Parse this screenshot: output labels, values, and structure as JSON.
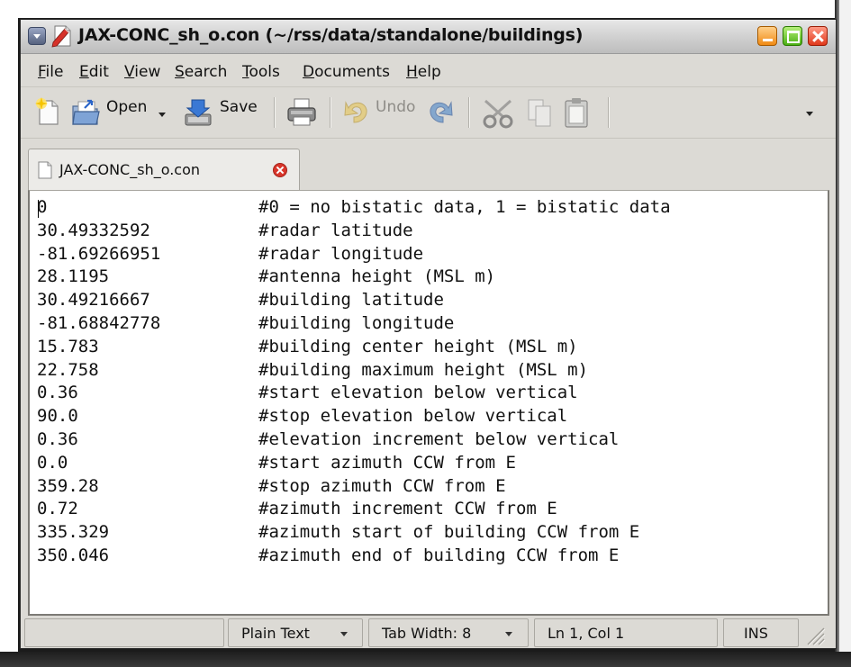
{
  "window": {
    "title": "JAX-CONC_sh_o.con (~/rss/data/standalone/buildings)"
  },
  "menu": [
    "File",
    "Edit",
    "View",
    "Search",
    "Tools",
    "Documents",
    "Help"
  ],
  "toolbar": {
    "new_icon": "new-document-icon",
    "open_label": "Open",
    "save_label": "Save",
    "print_icon": "print-icon",
    "undo_label": "Undo",
    "redo_icon": "redo-icon",
    "cut_icon": "cut-icon",
    "copy_icon": "copy-icon",
    "paste_icon": "paste-icon"
  },
  "tab": {
    "label": "JAX-CONC_sh_o.con"
  },
  "editor": {
    "lines": [
      {
        "value": "0",
        "comment": "#0 = no bistatic data, 1 = bistatic data"
      },
      {
        "value": "30.49332592",
        "comment": "#radar latitude"
      },
      {
        "value": "-81.69266951",
        "comment": "#radar longitude"
      },
      {
        "value": "28.1195",
        "comment": "#antenna height (MSL m)"
      },
      {
        "value": "30.49216667",
        "comment": "#building latitude"
      },
      {
        "value": "-81.68842778",
        "comment": "#building longitude"
      },
      {
        "value": "15.783",
        "comment": "#building center height (MSL m)"
      },
      {
        "value": "22.758",
        "comment": "#building maximum height (MSL m)"
      },
      {
        "value": "0.36",
        "comment": "#start elevation below vertical"
      },
      {
        "value": "90.0",
        "comment": "#stop elevation below vertical"
      },
      {
        "value": "0.36",
        "comment": "#elevation increment below vertical"
      },
      {
        "value": "0.0",
        "comment": "#start azimuth CCW from E"
      },
      {
        "value": "359.28",
        "comment": "#stop azimuth CCW from E"
      },
      {
        "value": "0.72",
        "comment": "#azimuth increment CCW from E"
      },
      {
        "value": "335.329",
        "comment": "#azimuth start of building CCW from E"
      },
      {
        "value": "350.046",
        "comment": "#azimuth end of building CCW from E"
      }
    ]
  },
  "statusbar": {
    "language": "Plain Text",
    "tab_width": "Tab Width: 8",
    "position": "Ln 1, Col 1",
    "mode": "INS"
  }
}
